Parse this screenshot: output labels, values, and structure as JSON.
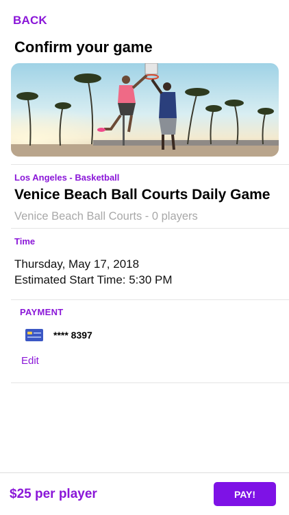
{
  "header": {
    "back_label": "BACK",
    "title": "Confirm your game"
  },
  "hero": {
    "icon": "basketball-players-photo"
  },
  "game": {
    "category": "Los Angeles - Basketball",
    "title": "Venice Beach Ball Courts Daily Game",
    "venue_line": "Venice Beach Ball Courts - 0 players"
  },
  "time": {
    "label": "Time",
    "date": "Thursday, May 17, 2018",
    "start": "Estimated Start Time: 5:30 PM"
  },
  "payment": {
    "label": "PAYMENT",
    "card_icon": "credit-card-icon",
    "card_number": "**** 8397",
    "edit_label": "Edit"
  },
  "footer": {
    "price": "$25 per player",
    "pay_label": "PAY!"
  },
  "colors": {
    "accent": "#8a16d8",
    "button": "#7e12e6",
    "muted_text": "#a8a8a8"
  }
}
